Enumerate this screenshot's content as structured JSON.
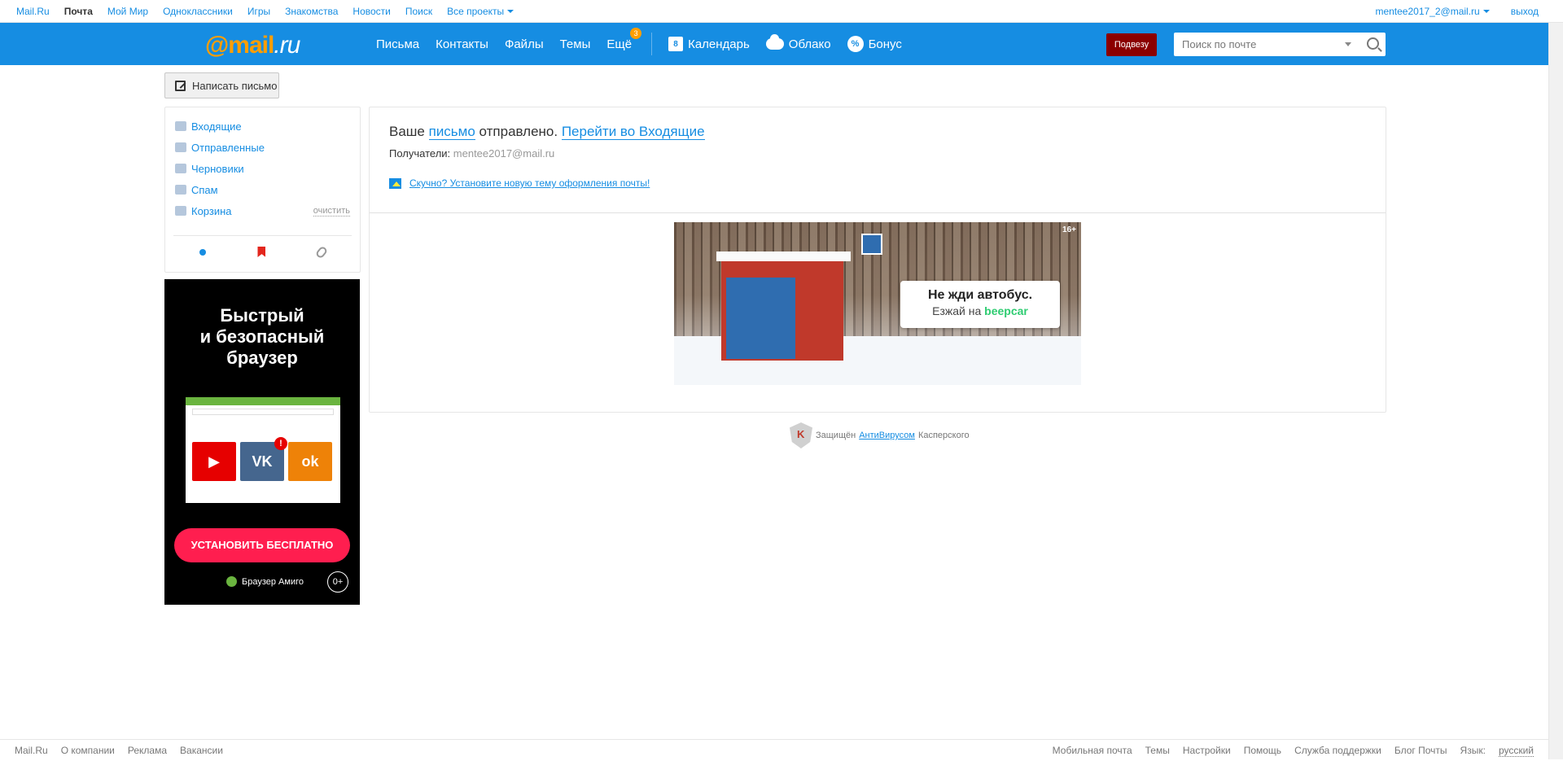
{
  "portal": {
    "links": [
      "Mail.Ru",
      "Почта",
      "Мой Мир",
      "Одноклассники",
      "Игры",
      "Знакомства",
      "Новости",
      "Поиск",
      "Все проекты"
    ],
    "user": "mentee2017_2@mail.ru",
    "logout": "выход"
  },
  "header": {
    "logo": {
      "at": "@",
      "mail": "mail",
      "ru": ".ru"
    },
    "nav": [
      "Письма",
      "Контакты",
      "Файлы",
      "Темы",
      "Ещё"
    ],
    "more_badge": "3",
    "services": [
      "Календарь",
      "Облако",
      "Бонус"
    ],
    "podvezu": "Подвезу",
    "search_placeholder": "Поиск по почте"
  },
  "compose": {
    "label": "Написать письмо"
  },
  "folders": {
    "items": [
      "Входящие",
      "Отправленные",
      "Черновики",
      "Спам",
      "Корзина"
    ],
    "clear": "очистить"
  },
  "ad_left": {
    "headline": [
      "Быстрый",
      "и безопасный",
      "браузер"
    ],
    "cta": "УСТАНОВИТЬ БЕСПЛАТНО",
    "brand": "Браузер Амиго",
    "age": "0+"
  },
  "main": {
    "sent_prefix": "Ваше ",
    "sent_link": "письмо",
    "sent_mid": " отправлено. ",
    "inbox_link": "Перейти во Входящие",
    "recipients_label": "Получатели: ",
    "recipients_value": "mentee2017@mail.ru",
    "theme_link": "Скучно? Установите новую тему оформления почты!"
  },
  "banner": {
    "line1": "Не жди автобус.",
    "line2_prefix": "Езжай на ",
    "line2_brand": "beepcar",
    "age": "16+"
  },
  "kaspersky": {
    "prefix": "Защищён ",
    "link": "АнтиВирусом",
    "suffix": " Касперского"
  },
  "footer": {
    "left": [
      "Mail.Ru",
      "О компании",
      "Реклама",
      "Вакансии"
    ],
    "right": [
      "Мобильная почта",
      "Темы",
      "Настройки",
      "Помощь",
      "Служба поддержки",
      "Блог Почты"
    ],
    "lang_label": "Язык:",
    "lang_value": "русский"
  },
  "colors": {
    "brand_blue": "#168de2",
    "logo_orange": "#ff9e00",
    "podvezu": "#8b0000"
  }
}
